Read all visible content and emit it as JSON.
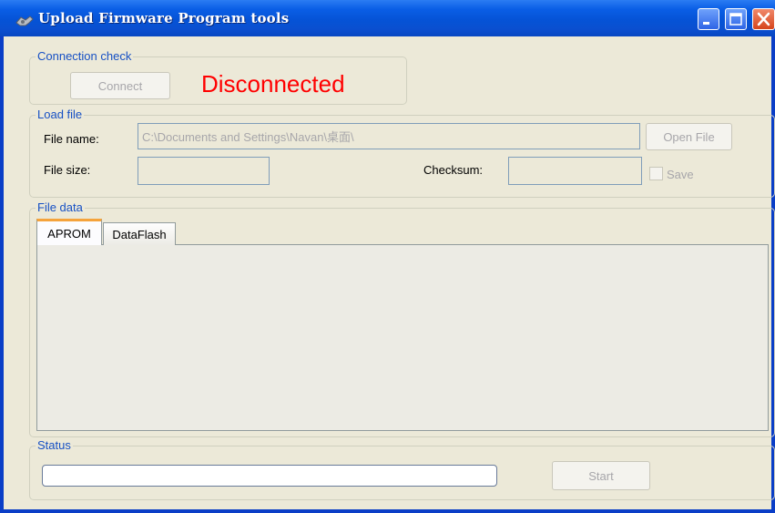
{
  "window": {
    "title": "Upload Firmware Program tools"
  },
  "connection": {
    "legend": "Connection check",
    "connect_label": "Connect",
    "status_text": "Disconnected",
    "status_color": "#ff0000"
  },
  "load_file": {
    "legend": "Load file",
    "file_name_label": "File name:",
    "file_name_value": "C:\\Documents and Settings\\Navan\\桌面\\",
    "open_file_label": "Open File",
    "file_size_label": "File size:",
    "file_size_value": "",
    "checksum_label": "Checksum:",
    "checksum_value": "",
    "save_label": "Save",
    "save_checked": false
  },
  "file_data": {
    "legend": "File data",
    "tabs": [
      {
        "label": "APROM",
        "active": true
      },
      {
        "label": "DataFlash",
        "active": false
      }
    ]
  },
  "status": {
    "legend": "Status",
    "progress": 0,
    "start_label": "Start"
  },
  "colors": {
    "titlebar": "#0553d6",
    "legend_text": "#1650c4",
    "disabled_text": "#a7a6aa",
    "window_bg": "#ece9d8"
  },
  "icons": {
    "app": "tool-icon",
    "minimize": "minimize-icon",
    "maximize": "maximize-icon",
    "close": "close-icon"
  }
}
